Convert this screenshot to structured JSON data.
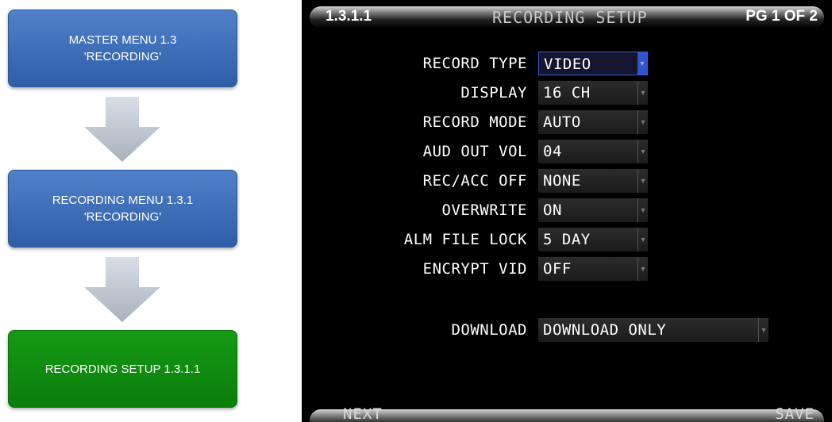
{
  "flow": {
    "box1": "MASTER MENU 1.3\n'RECORDING'",
    "box2": "RECORDING MENU 1.3.1\n'RECORDING'",
    "box3": "RECORDING SETUP 1.3.1.1"
  },
  "screen": {
    "menu_id": "1.3.1.1",
    "title": "RECORDING SETUP",
    "page": "PG 1 OF 2",
    "rows": [
      {
        "label": "RECORD TYPE",
        "value": "VIDEO"
      },
      {
        "label": "DISPLAY",
        "value": "16 CH"
      },
      {
        "label": "RECORD MODE",
        "value": "AUTO"
      },
      {
        "label": "AUD OUT VOL",
        "value": "04"
      },
      {
        "label": "REC/ACC OFF",
        "value": "NONE"
      },
      {
        "label": "OVERWRITE",
        "value": "ON"
      },
      {
        "label": "ALM FILE LOCK",
        "value": "5 DAY"
      },
      {
        "label": "ENCRYPT VID",
        "value": "OFF"
      }
    ],
    "download": {
      "label": "DOWNLOAD",
      "value": "DOWNLOAD ONLY"
    },
    "next_label": "NEXT",
    "save_label": "SAVE"
  },
  "colors": {
    "blue_box": "#3f6fba",
    "green_box": "#118a11",
    "active_field": "#2f55ce"
  },
  "icons": {
    "arrow": "down-arrow-icon",
    "dropdown": "chevron-down-icon"
  }
}
